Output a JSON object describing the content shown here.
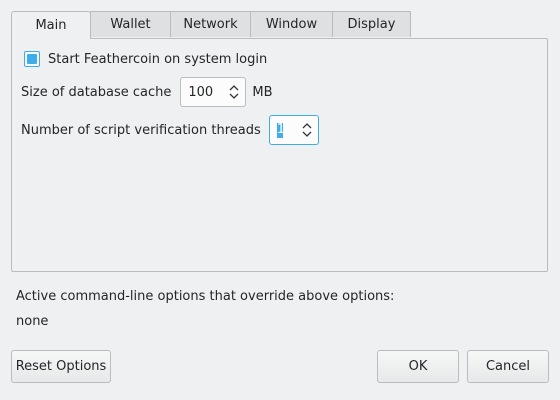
{
  "tabs": [
    {
      "label": "Main",
      "active": true
    },
    {
      "label": "Wallet",
      "active": false
    },
    {
      "label": "Network",
      "active": false
    },
    {
      "label": "Window",
      "active": false
    },
    {
      "label": "Display",
      "active": false
    }
  ],
  "main": {
    "start_on_login": {
      "label": "Start Feathercoin on system login",
      "checked": true
    },
    "db_cache": {
      "label": "Size of database cache",
      "value": "100",
      "unit": "MB"
    },
    "script_threads": {
      "label": "Number of script verification threads",
      "value": "1"
    }
  },
  "override": {
    "label": "Active command-line options that override above options:",
    "value": "none"
  },
  "buttons": {
    "reset": "Reset Options",
    "ok": "OK",
    "cancel": "Cancel"
  },
  "colors": {
    "accent": "#3daee9",
    "window_bg": "#eff0f1",
    "field_bg": "#fcfcfc",
    "border": "#b8bcbf",
    "text": "#232627"
  },
  "icons": {
    "spin_up": "chevron-up-icon",
    "spin_down": "chevron-down-icon"
  }
}
